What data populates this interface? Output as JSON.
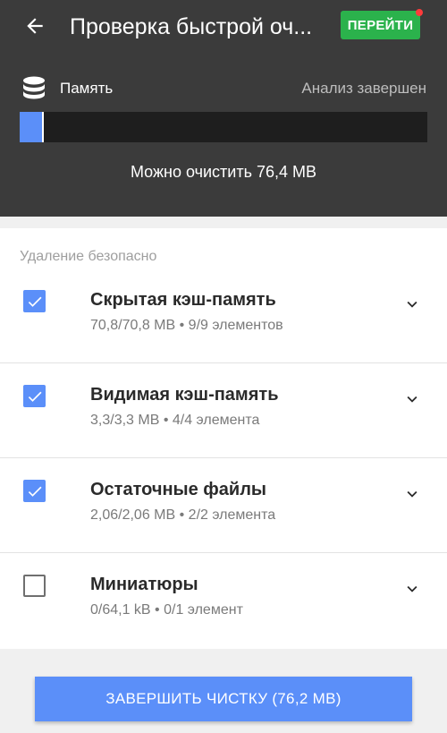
{
  "header": {
    "title": "Проверка быстрой оч...",
    "go_button": "ПЕРЕЙТИ",
    "memory_label": "Память",
    "status": "Анализ завершен",
    "progress_fraction": 0.06,
    "summary": "Можно очистить 76,4 MB"
  },
  "section_title": "Удаление безопасно",
  "items": [
    {
      "title": "Скрытая кэш-память",
      "subtitle": "70,8/70,8 MB • 9/9 элементов",
      "checked": true
    },
    {
      "title": "Видимая кэш-память",
      "subtitle": "3,3/3,3 MB • 4/4 элемента",
      "checked": true
    },
    {
      "title": "Остаточные файлы",
      "subtitle": "2,06/2,06 MB • 2/2 элемента",
      "checked": true
    },
    {
      "title": "Миниатюры",
      "subtitle": "0/64,1 kB • 0/1 элемент",
      "checked": false
    }
  ],
  "finish_button": "ЗАВЕРШИТЬ ЧИСТКУ (76,2 MB)",
  "colors": {
    "header_bg": "#3b3b3b",
    "accent": "#5b8ff9",
    "go_green": "#2bb24c",
    "notification_dot": "#ff3b3b"
  },
  "icons": [
    "back-arrow-icon",
    "database-icon",
    "checkbox-icon",
    "chevron-down-icon"
  ]
}
